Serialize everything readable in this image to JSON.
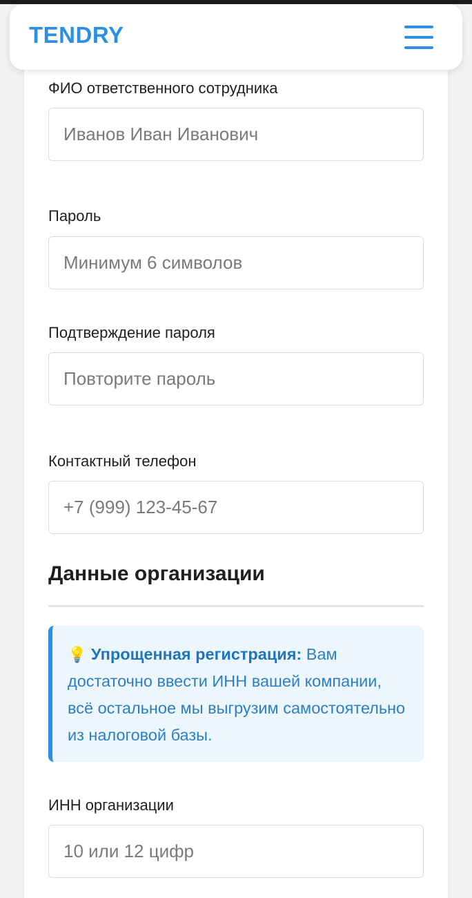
{
  "header": {
    "logo": "TENDRY",
    "menu_icon": "hamburger-menu-icon"
  },
  "form": {
    "fio": {
      "label": "ФИО ответственного сотрудника",
      "placeholder": "Иванов Иван Иванович",
      "value": ""
    },
    "password": {
      "label": "Пароль",
      "placeholder": "Минимум 6 символов",
      "value": ""
    },
    "password_confirm": {
      "label": "Подтверждение пароля",
      "placeholder": "Повторите пароль",
      "value": ""
    },
    "phone": {
      "label": "Контактный телефон",
      "placeholder": "+7 (999) 123-45-67",
      "value": ""
    }
  },
  "organization": {
    "title": "Данные организации",
    "info": {
      "icon": "lightbulb-icon",
      "emoji": "💡",
      "bold": "Упрощенная регистрация:",
      "text": " Вам достаточно ввести ИНН вашей компании, всё остальное мы выгрузим самостоятельно из налоговой базы."
    },
    "inn": {
      "label": "ИНН организации",
      "placeholder": "10 или 12 цифр",
      "value": ""
    }
  },
  "colors": {
    "accent": "#2b8fe3",
    "info_bg": "#eef6fd",
    "info_text": "#2b7fc4"
  }
}
